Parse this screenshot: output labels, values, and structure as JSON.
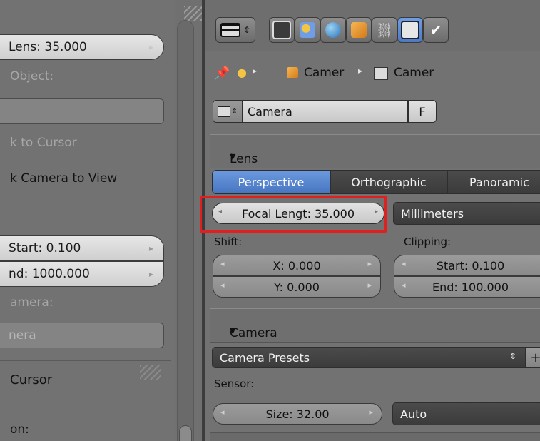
{
  "left_panel": {
    "lens_field": "Lens: 35.000",
    "to_object_label": "Object:",
    "to_object_value": "",
    "lock_cursor": "k to Cursor",
    "lock_camera": "k Camera to View",
    "clip_start": "Start: 0.100",
    "clip_end": "nd: 1000.000",
    "camera_label": "amera:",
    "camera_value": "nera",
    "cursor_header": "Cursor",
    "location_label": "on:"
  },
  "header": {
    "selected_tab": "camera-data-icon"
  },
  "breadcrumb": {
    "item1": "Camer",
    "item2": "Camer"
  },
  "datablock": {
    "name": "Camera",
    "fake_user": "F"
  },
  "lens_section": {
    "title": "Lens",
    "tabs": [
      "Perspective",
      "Orthographic",
      "Panoramic"
    ],
    "focal_length": "Focal Lengt: 35.000",
    "units": "Millimeters",
    "shift_label": "Shift:",
    "shift_x": "X: 0.000",
    "shift_y": "Y: 0.000",
    "clipping_label": "Clipping:",
    "clip_start": "Start: 0.100",
    "clip_end": "End: 100.000"
  },
  "camera_section": {
    "title": "Camera",
    "presets": "Camera Presets",
    "sensor_label": "Sensor:",
    "size": "Size: 32.00",
    "fit": "Auto"
  },
  "colors": {
    "accent_blue": "#5585d2",
    "highlight_red": "#e0201e"
  }
}
